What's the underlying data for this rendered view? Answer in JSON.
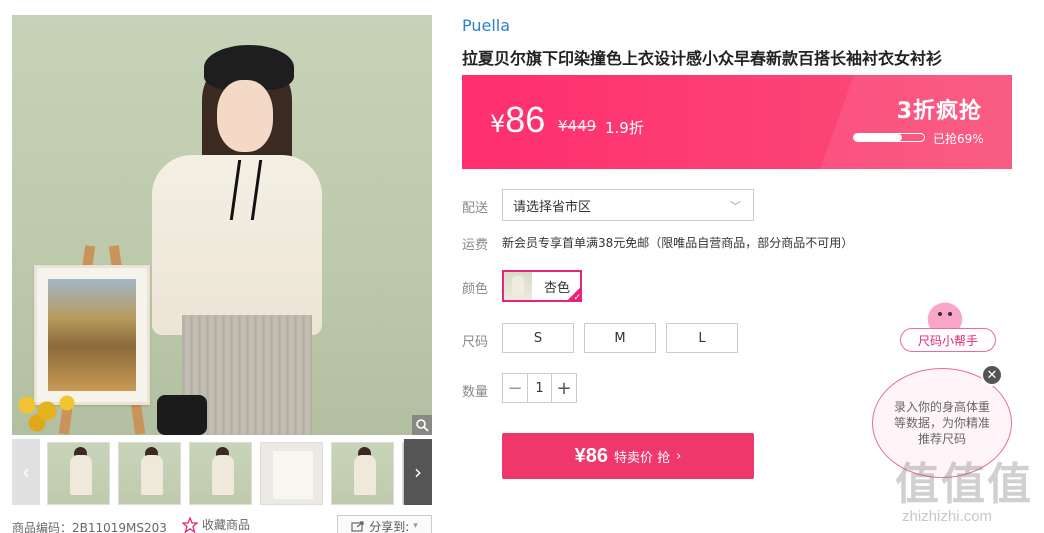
{
  "gallery": {
    "prev_arrow": "‹",
    "next_arrow": "›",
    "zoom_icon": "magnifier-icon",
    "thumbnails": [
      "thumb-1",
      "thumb-2",
      "thumb-3",
      "thumb-4",
      "thumb-5",
      "thumb-6"
    ]
  },
  "meta": {
    "product_code": "商品编码：2B11019MS203",
    "favorite_label": "收藏商品",
    "share_label": "分享到:"
  },
  "product": {
    "brand": "Puella",
    "title": "拉夏贝尔旗下印染撞色上衣设计感小众早春新款百搭长袖衬衣女衬衫"
  },
  "price": {
    "currency": "¥",
    "value": "86",
    "original": "¥449",
    "discount": "1.9折",
    "flash_title": "3折疯抢",
    "sold_percent": 69,
    "sold_text": "已抢69%",
    "colors": {
      "bar_start": "#ff2e6e",
      "bar_end": "#f94f78"
    }
  },
  "options": {
    "delivery_label": "配送",
    "delivery_value": "请选择省市区",
    "shipping_label": "运费",
    "shipping_text": "新会员专享首单满38元免邮（限唯品自营商品，部分商品不可用）",
    "color_label": "颜色",
    "color_selected": "杏色",
    "size_label": "尺码",
    "sizes": [
      "S",
      "M",
      "L"
    ],
    "qty_label": "数量",
    "qty_value": "1",
    "qty_minus": "−",
    "qty_plus": "+"
  },
  "buy": {
    "price": "¥86",
    "label": "特卖价 抢",
    "arrow": "›",
    "color": "#f0376b"
  },
  "helper": {
    "tag": "尺码小帮手",
    "bubble": "录入你的身高体重等数据，为你精准推荐尺码",
    "close": "✕"
  },
  "watermark": {
    "text": "值值值",
    "url": "zhizhizhi.com"
  }
}
